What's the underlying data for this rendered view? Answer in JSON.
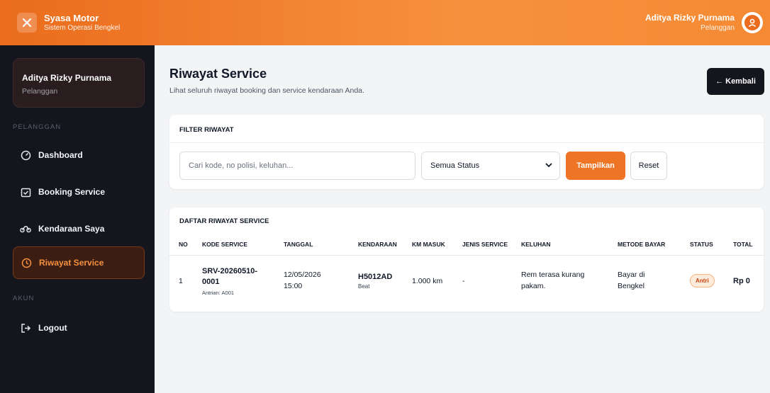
{
  "brand": {
    "name": "Syasa Motor",
    "subtitle": "Sistem Operasi Bengkel",
    "logo_icon": "wrench-icon"
  },
  "user": {
    "name": "Aditya Rizky Purnama",
    "role": "Pelanggan"
  },
  "sidebar": {
    "profile": {
      "name": "Aditya Rizky Purnama",
      "role": "Pelanggan"
    },
    "section_pelanggan": "PELANGGAN",
    "section_akun": "AKUN",
    "items": [
      {
        "label": "Dashboard",
        "icon": "dashboard-icon",
        "active": false
      },
      {
        "label": "Booking Service",
        "icon": "calendar-check-icon",
        "active": false
      },
      {
        "label": "Kendaraan Saya",
        "icon": "motorcycle-icon",
        "active": false
      },
      {
        "label": "Riwayat Service",
        "icon": "history-icon",
        "active": true
      },
      {
        "label": "Logout",
        "icon": "logout-icon",
        "active": false
      }
    ]
  },
  "page": {
    "title": "Riwayat Service",
    "subtitle": "Lihat seluruh riwayat booking dan service kendaraan Anda.",
    "back_button": "← Kembali"
  },
  "filter": {
    "heading": "FILTER RIWAYAT",
    "search_placeholder": "Cari kode, no polisi, keluhan...",
    "search_value": "",
    "status_selected": "Semua Status",
    "submit_label": "Tampilkan",
    "reset_label": "Reset"
  },
  "list": {
    "heading": "DAFTAR RIWAYAT SERVICE",
    "columns": [
      "NO",
      "KODE SERVICE",
      "TANGGAL",
      "KENDARAAN",
      "KM MASUK",
      "JENIS SERVICE",
      "KELUHAN",
      "METODE BAYAR",
      "STATUS",
      "TOTAL"
    ],
    "rows": [
      {
        "no": "1",
        "code": "SRV-20260510-0001",
        "queue": "Antrian: A001",
        "date": "12/05/2026 15:00",
        "plate": "H5012AD",
        "model": "Beat",
        "km": "1.000 km",
        "service_type": "-",
        "complaint": "Rem terasa kurang pakam.",
        "payment": "Bayar di Bengkel",
        "status": "Antri",
        "total": "Rp 0"
      }
    ]
  },
  "colors": {
    "accent": "#ee7426",
    "sidebar_bg": "#14151d",
    "active_bg": "#3b1d12"
  }
}
